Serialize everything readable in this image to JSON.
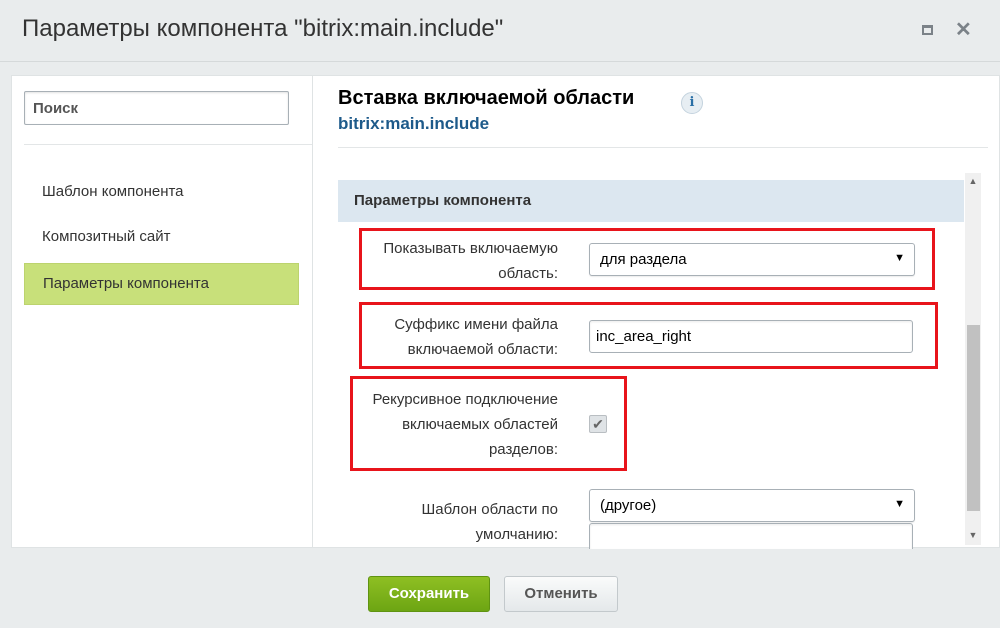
{
  "window": {
    "title": "Параметры компонента \"bitrix:main.include\""
  },
  "sidebar": {
    "search_placeholder": "Поиск",
    "items": [
      {
        "label": "Шаблон компонента",
        "active": false
      },
      {
        "label": "Композитный сайт",
        "active": false
      },
      {
        "label": "Параметры компонента",
        "active": true
      }
    ]
  },
  "component": {
    "title": "Вставка включаемой области",
    "code": "bitrix:main.include"
  },
  "section": {
    "title": "Параметры компонента"
  },
  "params": {
    "show_area": {
      "label_line1": "Показывать включаемую",
      "label_line2": "область:",
      "value": "для раздела"
    },
    "suffix": {
      "label_line1": "Суффикс имени файла",
      "label_line2": "включаемой области:",
      "value": "inc_area_right"
    },
    "recursive": {
      "label_line1": "Рекурсивное подключение",
      "label_line2": "включаемых областей",
      "label_line3": "разделов:",
      "checked": true
    },
    "template": {
      "label_line1": "Шаблон области по",
      "label_line2": "умолчанию:",
      "value": "(другое)",
      "extra_value": ""
    }
  },
  "footer": {
    "save_label": "Сохранить",
    "cancel_label": "Отменить"
  },
  "colors": {
    "accent_green": "#8ebf23",
    "active_nav": "#c8e07a",
    "highlight_red": "#e8141b",
    "section_bg": "#dce7f0"
  }
}
